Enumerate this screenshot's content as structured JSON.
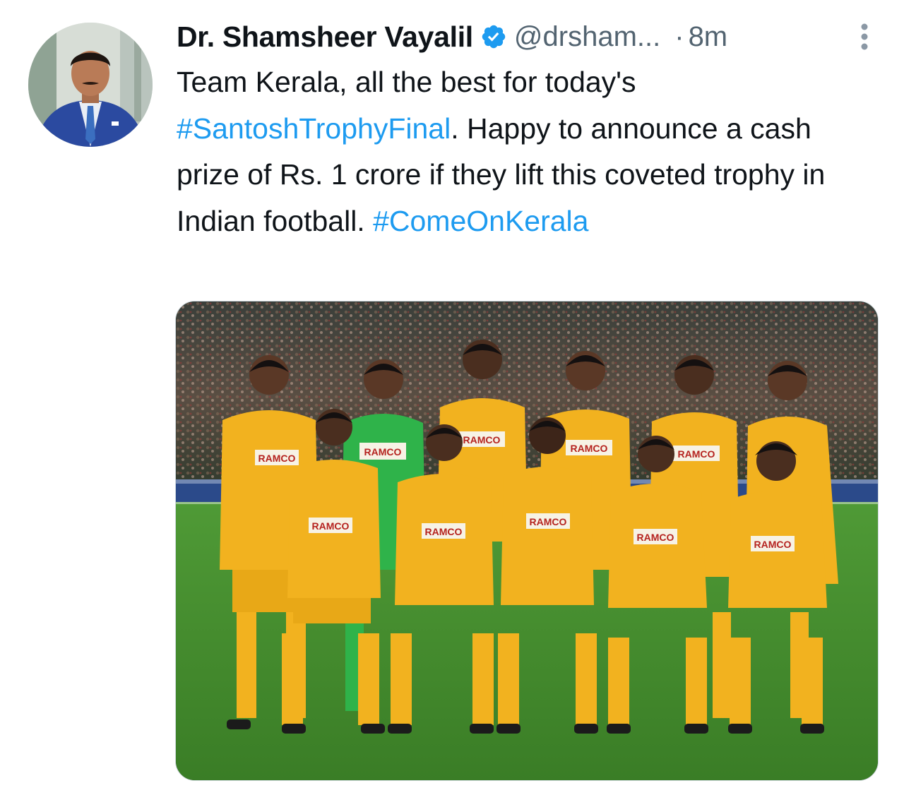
{
  "tweet": {
    "author": {
      "display_name": "Dr. Shamsheer Vayalil",
      "handle": "@drsham...",
      "verified": true
    },
    "separator": "·",
    "time": "8m",
    "text_segments": [
      {
        "text": "Team Kerala, all the best for today's ",
        "type": "text"
      },
      {
        "text": "#SantoshTrophyFinal",
        "type": "hashtag"
      },
      {
        "text": ". Happy to announce a cash prize of Rs. 1 crore if they lift this coveted trophy in Indian football. ",
        "type": "text"
      },
      {
        "text": "#ComeOnKerala",
        "type": "hashtag"
      }
    ],
    "media": {
      "sponsor_text": "RAMCO"
    }
  },
  "colors": {
    "hashtag": "#1d9bf0",
    "verified": "#1d9bf0",
    "muted_text": "#536471",
    "kit_yellow": "#f2b21f",
    "goalkeeper_green": "#2fb34a",
    "pitch_green": "#3f8a2c"
  },
  "icons": {
    "verified": "verified-badge-icon",
    "more": "more-vertical-icon"
  }
}
